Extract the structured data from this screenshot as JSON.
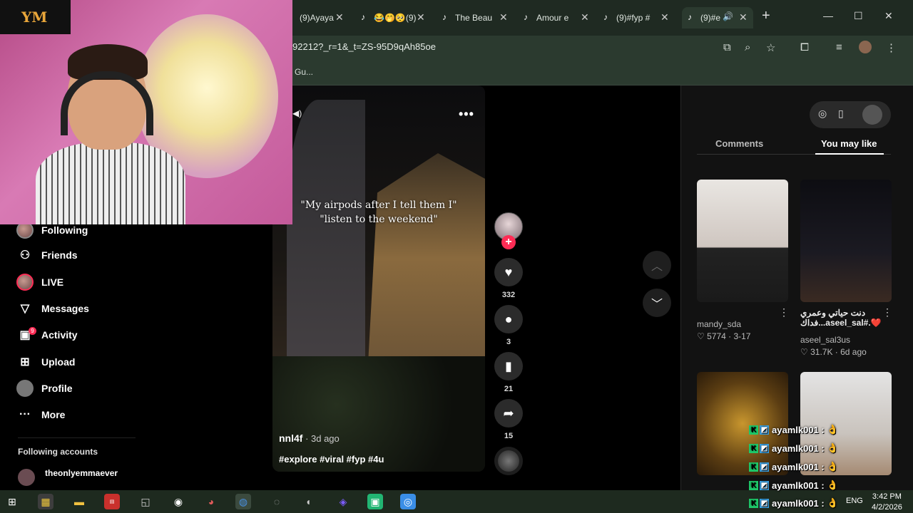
{
  "browser": {
    "tabs": [
      {
        "title": "(9)Ayaya",
        "active": false
      },
      {
        "title": "😂🤭🥺(9)",
        "active": false
      },
      {
        "title": "The Beau",
        "active": false
      },
      {
        "title": "Amour e",
        "active": false
      },
      {
        "title": "(9)#fyp #",
        "active": false
      },
      {
        "title": "(9)#e",
        "active": true
      }
    ],
    "new_tab": "+",
    "url": "92212?_r=1&_t=ZS-95D9qAh85oe",
    "bookmark": "Gu..."
  },
  "overlay": {
    "logo": "YM"
  },
  "sidebar": {
    "items": [
      {
        "label": "Following",
        "icon": "following-icon"
      },
      {
        "label": "Friends",
        "icon": "friends-icon"
      },
      {
        "label": "LIVE",
        "icon": "live-icon"
      },
      {
        "label": "Messages",
        "icon": "messages-icon"
      },
      {
        "label": "Activity",
        "icon": "activity-icon"
      },
      {
        "label": "Upload",
        "icon": "upload-icon"
      },
      {
        "label": "Profile",
        "icon": "profile-icon"
      },
      {
        "label": "More",
        "icon": "more-icon"
      }
    ],
    "activity_badge": "9",
    "following_accounts_title": "Following accounts",
    "following_accounts": [
      {
        "name": "theonlyemmaever"
      }
    ]
  },
  "video": {
    "caption_line1": "\"My airpods after I tell them I\"",
    "caption_line2": "\"listen to the weekend\"",
    "author": "nnl4f",
    "date": " · 3d ago",
    "tags": "#explore #viral #fyp #4u",
    "likes": "332",
    "comments": "3",
    "saves": "21",
    "shares": "15"
  },
  "panel": {
    "tab_comments": "Comments",
    "tab_you_may_like": "You may like",
    "cards": [
      {
        "title": "",
        "user": "mandy_sda",
        "stats": "5774 · 3-17"
      },
      {
        "title": "دنت حياتي وعمري ❤️.#aseel_sal...فداك",
        "user": "aseel_sal3us",
        "stats": "31.7K · 6d ago"
      },
      {
        "title": "",
        "user": "",
        "stats": ""
      },
      {
        "title": "",
        "user": "",
        "stats": ""
      }
    ]
  },
  "chat": {
    "lines": [
      {
        "user": "ayamlk001 :",
        "msg": "👌"
      },
      {
        "user": "ayamlk001 :",
        "msg": "👌"
      },
      {
        "user": "ayamlk001 :",
        "msg": "👌"
      },
      {
        "user": "ayamlk001 :",
        "msg": "👌"
      },
      {
        "user": "ayamlk001 :",
        "msg": "👌"
      }
    ]
  },
  "taskbar": {
    "lang": "ENG",
    "time": "3:42 PM",
    "date": "4/2/2026"
  },
  "colors": {
    "accent": "#fe2c55",
    "chrome_bg": "#2b3a2f",
    "panel_bg": "#121212"
  }
}
